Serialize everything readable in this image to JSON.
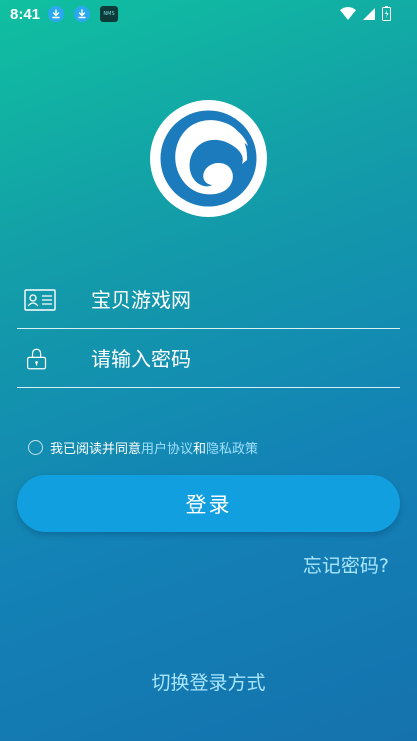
{
  "status_bar": {
    "time": "8:41",
    "icons": [
      "download-icon",
      "download-icon",
      "nms-icon",
      "wifi-icon",
      "signal-icon",
      "battery-icon"
    ],
    "nms_label": "NMS"
  },
  "logo": {
    "icon": "app-logo",
    "colors": [
      "#ffffff",
      "#1b7bbd"
    ]
  },
  "form": {
    "username": {
      "value": "宝贝游戏网",
      "icon": "id-card-icon"
    },
    "password": {
      "placeholder": "请输入密码",
      "icon": "lock-icon"
    }
  },
  "agreement": {
    "prefix": "我已阅读并同意",
    "user_agreement": "用户协议",
    "conjunction": "和",
    "privacy_policy": "隐私政策",
    "checked": false
  },
  "login_button": {
    "label": "登录"
  },
  "forgot_password": {
    "label": "忘记密码?"
  },
  "switch_login": {
    "label": "切换登录方式"
  },
  "colors": {
    "accent": "#119fe0",
    "link": "#a8e6ff",
    "bg_top": "#10c0a0",
    "bg_bottom": "#1572ad"
  }
}
